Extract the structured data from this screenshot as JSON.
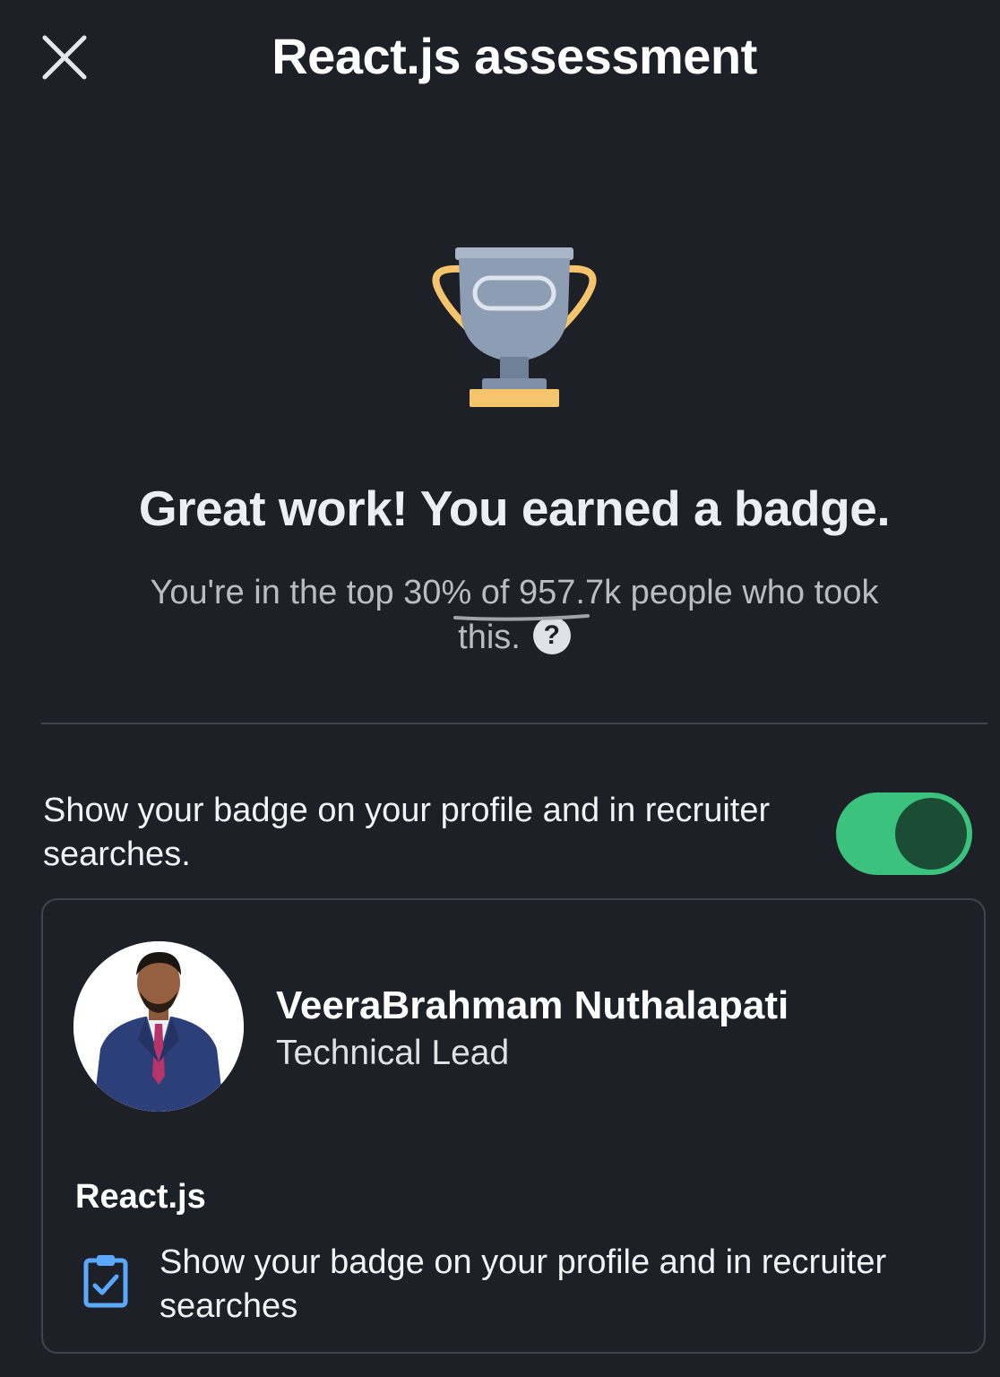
{
  "header": {
    "title": "React.js assessment",
    "close_icon": "close-icon"
  },
  "result": {
    "trophy_icon": "trophy-icon",
    "headline": "Great work! You earned a badge.",
    "subtext": "You're in the top 30% of 957.7k people who took this.",
    "help_icon": "?"
  },
  "visibility": {
    "label": "Show your badge on your profile and in recruiter searches.",
    "toggle_on": true
  },
  "profile_card": {
    "name": "VeeraBrahmam Nuthalapati",
    "role": "Technical Lead",
    "skill": "React.js",
    "description": "Show your badge on your profile and in recruiter searches",
    "description_icon": "clipboard-check-icon"
  },
  "colors": {
    "background": "#1d2026",
    "toggle_track": "#3bc37d",
    "toggle_knob": "#1a4d33",
    "trophy_cup": "#8d9db3",
    "trophy_gold": "#f5c46c",
    "clipboard": "#5aa9ff"
  }
}
